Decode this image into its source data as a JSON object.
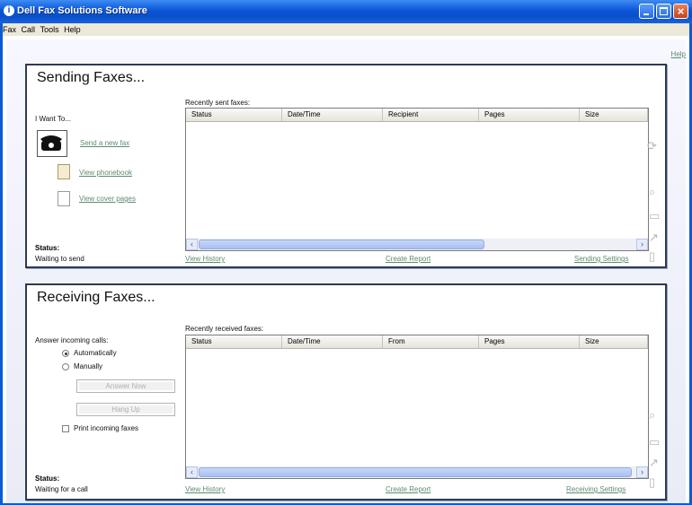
{
  "window": {
    "title": "Dell Fax Solutions Software",
    "help_link": "Help"
  },
  "menubar": [
    "Fax",
    "Call",
    "Tools",
    "Help"
  ],
  "sending": {
    "heading": "Sending Faxes...",
    "i_want_to": "I Want To...",
    "actions": {
      "send": "Send a new fax",
      "phonebook": "View phonebook",
      "cover_pages": "View cover pages"
    },
    "list_caption": "Recently sent faxes:",
    "columns": [
      "Status",
      "Date/Time",
      "Recipient",
      "Pages",
      "Size"
    ],
    "status_label": "Status:",
    "status_value": "Waiting to send",
    "footer_links": {
      "history": "View History",
      "report": "Create Report",
      "settings": "Sending Settings"
    }
  },
  "receiving": {
    "heading": "Receiving Faxes...",
    "answer_label": "Answer incoming calls:",
    "options": {
      "auto": "Automatically",
      "manual": "Manually"
    },
    "selected_option": "Automatically",
    "buttons": {
      "answer_now": "Answer Now",
      "hang_up": "Hang Up"
    },
    "print_label": "Print incoming faxes",
    "print_checked": false,
    "list_caption": "Recently received faxes:",
    "columns": [
      "Status",
      "Date/Time",
      "From",
      "Pages",
      "Size"
    ],
    "status_label": "Status:",
    "status_value": "Waiting for a call",
    "footer_links": {
      "history": "View History",
      "report": "Create Report",
      "settings": "Receiving Settings"
    }
  },
  "colors": {
    "titlebar": "#0a56d8",
    "link": "#5e8a70",
    "panel_border": "#2d3a56"
  }
}
